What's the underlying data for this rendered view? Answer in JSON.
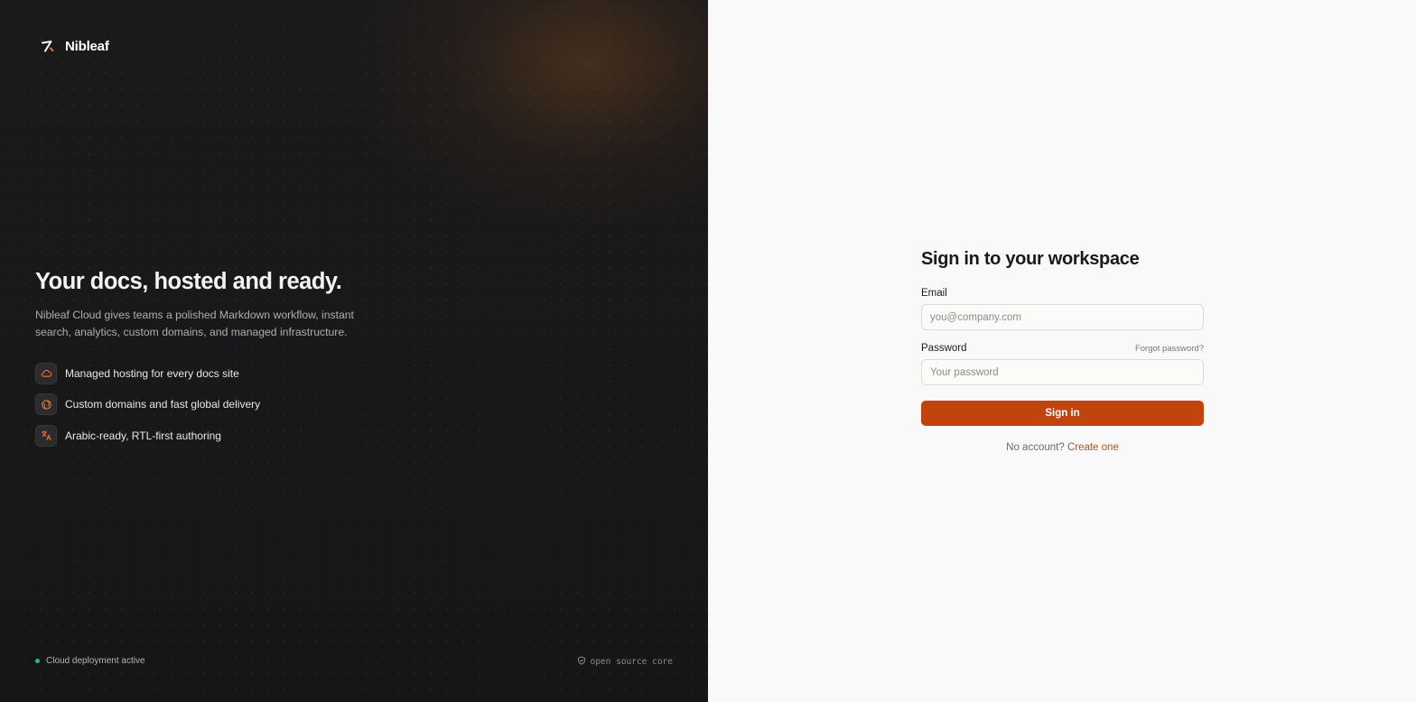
{
  "brand": {
    "name": "Nibleaf",
    "logo_icon": "pen-nib-icon"
  },
  "hero": {
    "title": "Your docs, hosted and ready.",
    "description": "Nibleaf Cloud gives teams a polished Markdown workflow, instant search, analytics, custom domains, and managed infrastructure."
  },
  "features": [
    {
      "icon": "cloud-icon",
      "label": "Managed hosting for every docs site"
    },
    {
      "icon": "globe-icon",
      "label": "Custom domains and fast global delivery"
    },
    {
      "icon": "translate-icon",
      "label": "Arabic-ready, RTL-first authoring"
    }
  ],
  "footer": {
    "status": "Cloud deployment active",
    "status_color": "#22c55e",
    "badge": "open source core",
    "badge_icon": "shield-icon"
  },
  "form": {
    "title": "Sign in to your workspace",
    "email_label": "Email",
    "email_placeholder": "you@company.com",
    "email_value": "",
    "password_label": "Password",
    "forgot_label": "Forgot password?",
    "password_placeholder": "Your password",
    "password_value": "",
    "submit_label": "Sign in",
    "signup_prompt": "No account?",
    "signup_link": "Create one"
  },
  "colors": {
    "accent": "#c1440e",
    "accent_link": "#b8501a",
    "left_bg": "#17171a",
    "right_bg": "#f9f9f9"
  }
}
